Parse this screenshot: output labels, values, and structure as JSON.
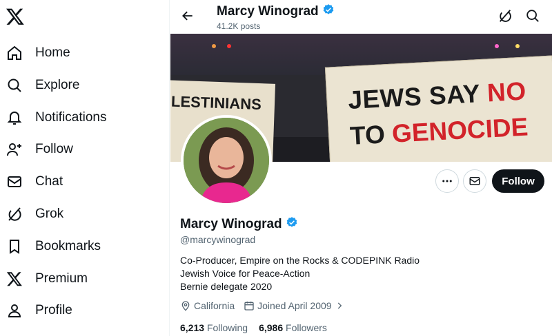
{
  "nav": {
    "items": [
      {
        "label": "Home",
        "icon": "home-icon"
      },
      {
        "label": "Explore",
        "icon": "search-icon"
      },
      {
        "label": "Notifications",
        "icon": "bell-icon"
      },
      {
        "label": "Follow",
        "icon": "add-user-icon"
      },
      {
        "label": "Chat",
        "icon": "mail-icon"
      },
      {
        "label": "Grok",
        "icon": "grok-icon"
      },
      {
        "label": "Bookmarks",
        "icon": "bookmark-icon"
      },
      {
        "label": "Premium",
        "icon": "x-logo-icon"
      },
      {
        "label": "Profile",
        "icon": "user-icon"
      }
    ]
  },
  "header": {
    "name": "Marcy Winograd",
    "posts": "41.2K posts"
  },
  "banner": {
    "sign_line1_a": "JEWS SAY ",
    "sign_line1_b": "NO",
    "sign_line2_a": "TO ",
    "sign_line2_b": "GENOCIDE",
    "sign_left": "LESTINIANS"
  },
  "profile": {
    "name": "Marcy Winograd",
    "handle": "@marcywinograd",
    "bio": [
      "Co-Producer, Empire on the Rocks & CODEPINK Radio",
      "Jewish Voice for Peace-Action",
      "Bernie delegate 2020"
    ],
    "location": "California",
    "joined": "Joined April 2009",
    "following_count": "6,213",
    "following_label": "Following",
    "followers_count": "6,986",
    "followers_label": "Followers",
    "follow_button": "Follow"
  },
  "colors": {
    "verified": "#1d9bf0",
    "accent_dark": "#0f1419",
    "muted": "#536471"
  }
}
